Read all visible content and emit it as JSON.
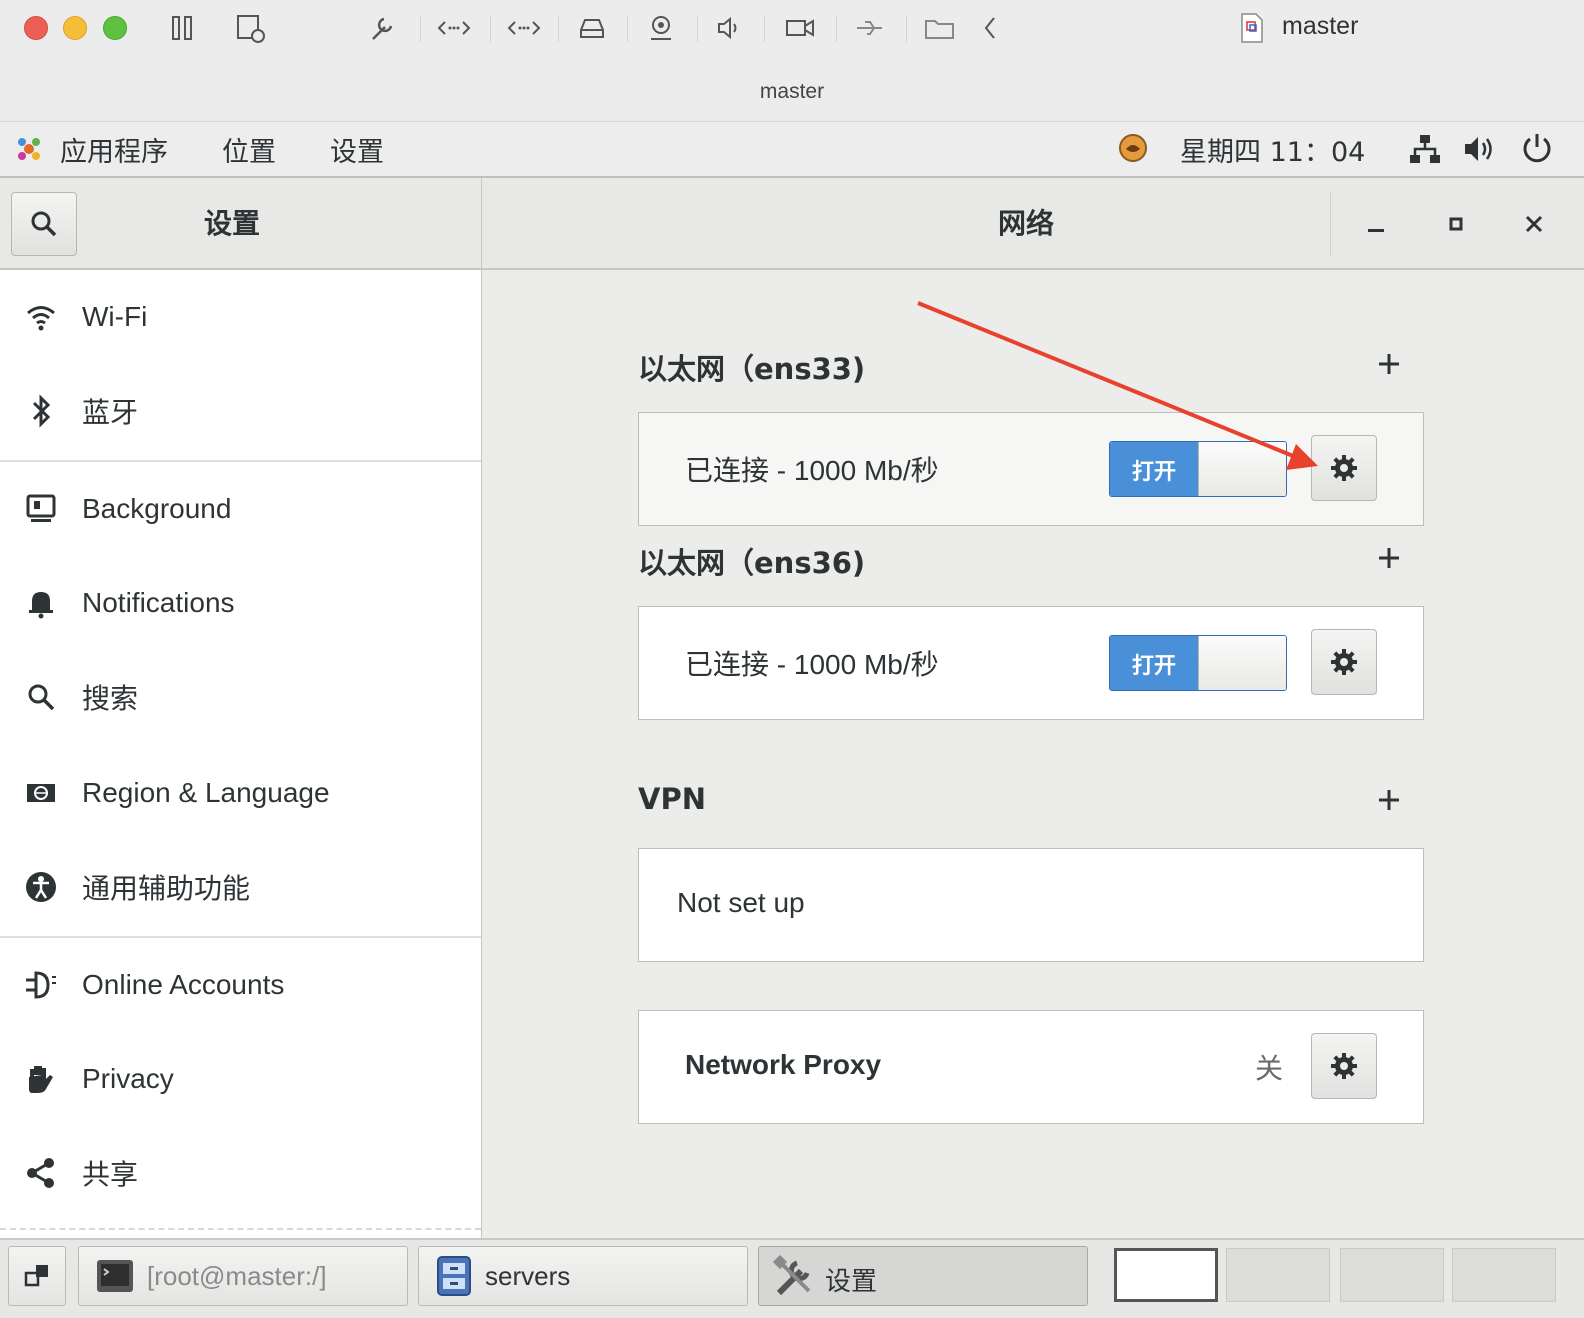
{
  "host": {
    "title": "master",
    "subtitle": "master"
  },
  "panel": {
    "apps_menu": "应用程序",
    "places_menu": "位置",
    "settings_menu": "设置",
    "clock": "星期四 11：04"
  },
  "settings_header": {
    "left_title": "设置",
    "right_title": "网络"
  },
  "sidebar": {
    "items": [
      {
        "label": "Wi-Fi",
        "icon": "wifi-icon"
      },
      {
        "label": "蓝牙",
        "icon": "bluetooth-icon"
      },
      {
        "label": "Background",
        "icon": "monitor-icon"
      },
      {
        "label": "Notifications",
        "icon": "bell-icon"
      },
      {
        "label": "搜索",
        "icon": "search-icon"
      },
      {
        "label": "Region & Language",
        "icon": "region-icon"
      },
      {
        "label": "通用辅助功能",
        "icon": "accessibility-icon"
      },
      {
        "label": "Online Accounts",
        "icon": "online-accounts-icon"
      },
      {
        "label": "Privacy",
        "icon": "hand-icon"
      },
      {
        "label": "共享",
        "icon": "share-icon"
      }
    ]
  },
  "network": {
    "ethernet1": {
      "title": "以太网（ens33)",
      "status": "已连接 - 1000 Mb/秒",
      "switch_label": "打开"
    },
    "ethernet2": {
      "title": "以太网（ens36)",
      "status": "已连接 - 1000 Mb/秒",
      "switch_label": "打开"
    },
    "vpn": {
      "title": "VPN",
      "status": "Not set up"
    },
    "proxy": {
      "label": "Network Proxy",
      "state": "关"
    }
  },
  "taskbar": {
    "items": [
      {
        "label": "[root@master:/]",
        "icon": "terminal-icon"
      },
      {
        "label": "servers",
        "icon": "file-cabinet-icon"
      },
      {
        "label": "设置",
        "icon": "tools-icon"
      }
    ]
  },
  "annotation": {
    "arrow_color": "#e8412c"
  },
  "colors": {
    "switch_on": "#4a90d9"
  }
}
